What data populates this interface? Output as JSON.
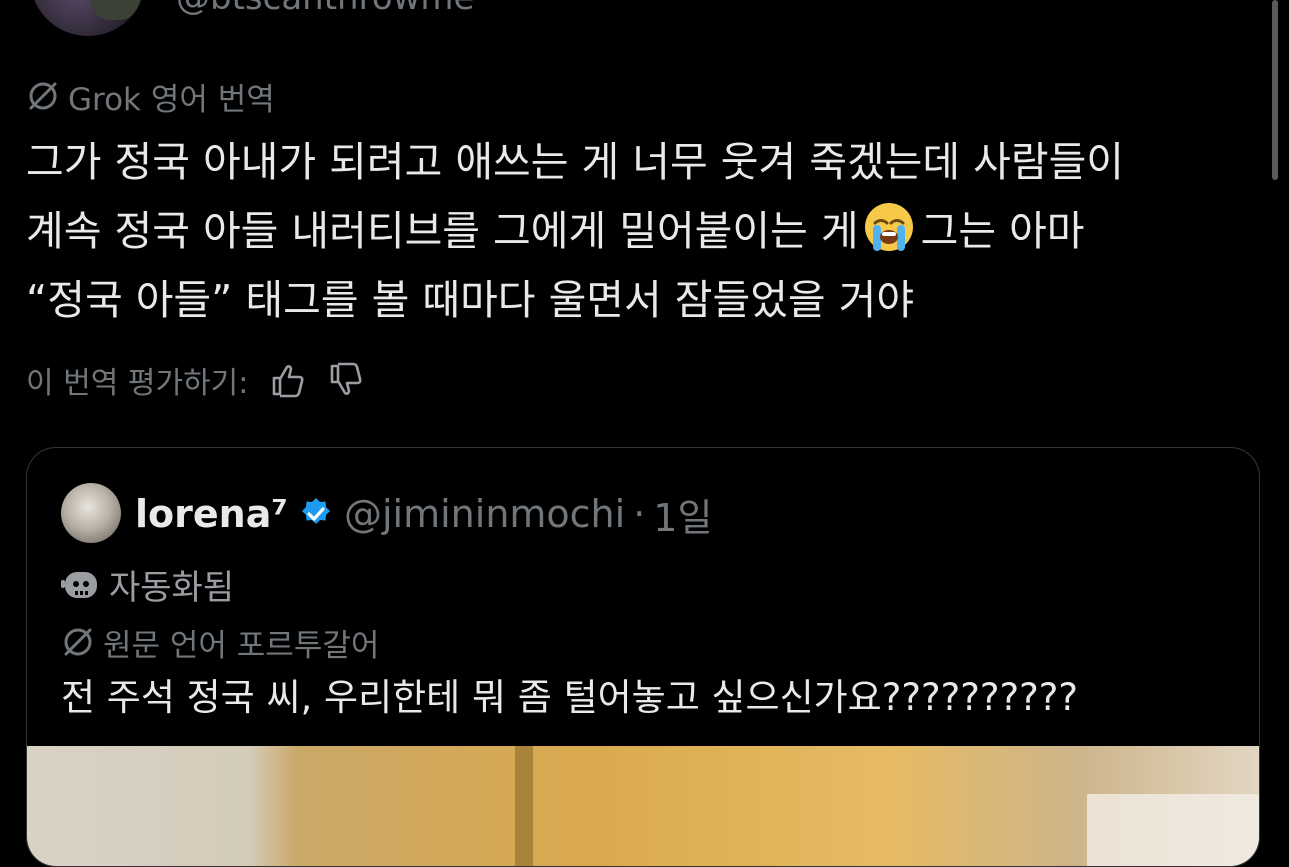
{
  "top_user": {
    "handle": "@btscanthrowme"
  },
  "translation": {
    "label": "Grok 영어 번역"
  },
  "tweet": {
    "lines": [
      "그가 정국 아내가 되려고 애쓰는 게 너무 웃겨 죽겠는데 사람들이",
      "계속 정국 아들 내러티브를 그에게 밀어붙이는 게",
      "그는 아마",
      "“정국 아들” 태그를 볼 때마다 울면서 잠들었을 거야"
    ],
    "emoji": "loudly-crying-face"
  },
  "rate": {
    "label": "이 번역 평가하기:"
  },
  "quote": {
    "name": "lorena⁷",
    "handle": "@jimininmochi",
    "separator": "·",
    "time": "1일",
    "automated_label": "자동화됨",
    "source_language": "원문 언어 포르투갈어",
    "text": "전 주석 정국 씨, 우리한테 뭐 좀 털어놓고 싶으신가요??????????"
  },
  "colors": {
    "background": "#000000",
    "text": "#e7e9ea",
    "muted": "#71767b",
    "verified": "#1d9bf0"
  }
}
